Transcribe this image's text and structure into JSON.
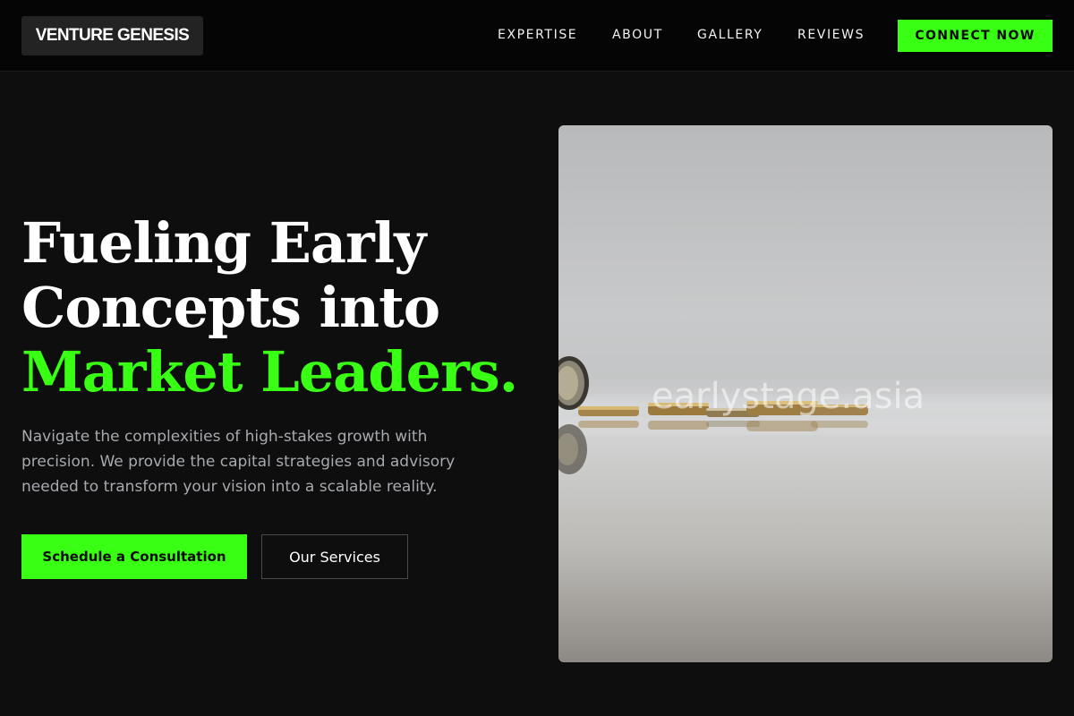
{
  "header": {
    "logo": "VENTURE GENESIS",
    "nav": [
      {
        "label": "EXPERTISE"
      },
      {
        "label": "ABOUT"
      },
      {
        "label": "GALLERY"
      },
      {
        "label": "REVIEWS"
      }
    ],
    "cta_label": "CONNECT NOW"
  },
  "hero": {
    "title_line1": "Fueling Early",
    "title_line2": "Concepts into",
    "title_line3": "Market Leaders.",
    "description": "Navigate the complexities of high-stakes growth with precision. We provide the capital strategies and advisory needed to transform your vision into a scalable reality.",
    "primary_button": "Schedule a Consultation",
    "secondary_button": "Our Services",
    "image_watermark": "earlystage.asia"
  },
  "colors": {
    "accent": "#39ff14",
    "background": "#0e0e0e",
    "header_bg": "#050505",
    "muted_text": "#a6a9ae"
  }
}
